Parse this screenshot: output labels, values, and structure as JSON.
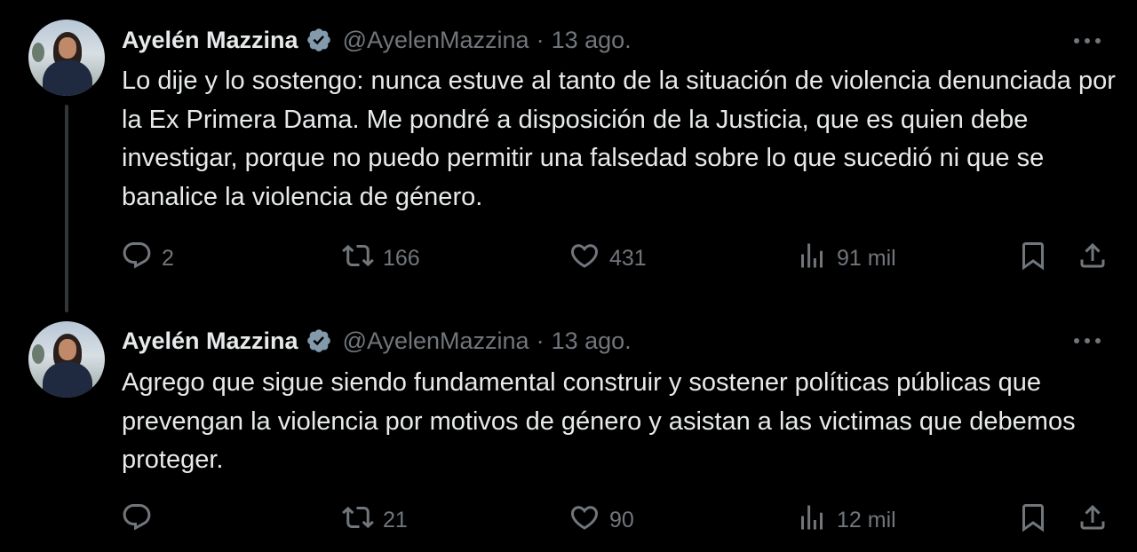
{
  "tweets": [
    {
      "author_name": "Ayelén Mazzina",
      "handle": "@AyelenMazzina",
      "separator": "·",
      "date": "13 ago.",
      "text": "Lo dije y lo sostengo: nunca estuve al tanto de la situación de violencia denunciada por la Ex Primera Dama. Me pondré a disposición de la Justicia, que es quien debe investigar, porque no puedo permitir una falsedad sobre lo que sucedió ni que se banalice la violencia de género.",
      "replies": "2",
      "retweets": "166",
      "likes": "431",
      "views": "91 mil"
    },
    {
      "author_name": "Ayelén Mazzina",
      "handle": "@AyelenMazzina",
      "separator": "·",
      "date": "13 ago.",
      "text": "Agrego que sigue siendo fundamental construir y sostener políticas públicas que prevengan la violencia por motivos de género y asistan a las victimas que debemos proteger.",
      "replies": "",
      "retweets": "21",
      "likes": "90",
      "views": "12 mil"
    }
  ],
  "icons": {
    "verified": "verified-badge-icon",
    "more": "more-options-icon",
    "reply": "reply-icon",
    "retweet": "retweet-icon",
    "like": "heart-icon",
    "views": "views-chart-icon",
    "bookmark": "bookmark-icon",
    "share": "share-icon"
  },
  "colors": {
    "background": "#000000",
    "text": "#e7e9ea",
    "muted": "#71767b",
    "verified": "#829aab",
    "thread_line": "#333639"
  }
}
